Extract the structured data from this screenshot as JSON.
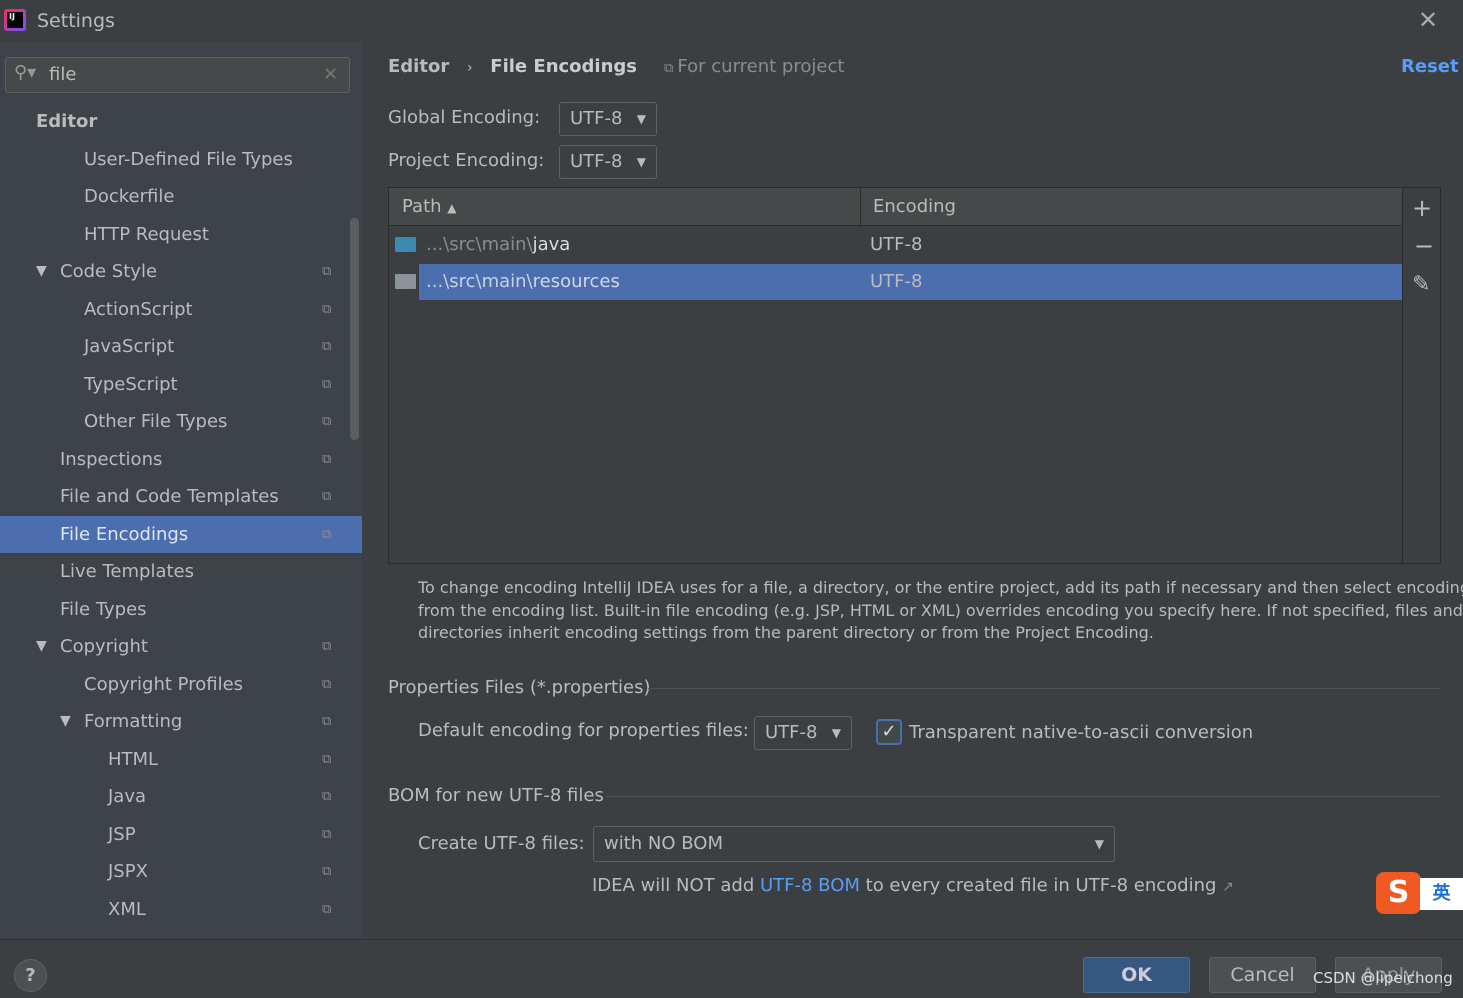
{
  "window": {
    "title": "Settings",
    "close_icon": "close-icon",
    "app_icon": "intellij-idea-logo"
  },
  "search": {
    "value": "file"
  },
  "tree": [
    {
      "label": "Editor",
      "level": 0,
      "bold": true
    },
    {
      "label": "User-Defined File Types",
      "level": 2
    },
    {
      "label": "Dockerfile",
      "level": 2
    },
    {
      "label": "HTTP Request",
      "level": 2
    },
    {
      "label": "Code Style",
      "level": 1,
      "expanded": true,
      "copy": true
    },
    {
      "label": "ActionScript",
      "level": 2,
      "copy": true
    },
    {
      "label": "JavaScript",
      "level": 2,
      "copy": true
    },
    {
      "label": "TypeScript",
      "level": 2,
      "copy": true
    },
    {
      "label": "Other File Types",
      "level": 2,
      "copy": true
    },
    {
      "label": "Inspections",
      "level": 1,
      "copy": true
    },
    {
      "label": "File and Code Templates",
      "level": 1,
      "copy": true
    },
    {
      "label": "File Encodings",
      "level": 1,
      "copy": true,
      "selected": true
    },
    {
      "label": "Live Templates",
      "level": 1
    },
    {
      "label": "File Types",
      "level": 1
    },
    {
      "label": "Copyright",
      "level": 1,
      "expanded": true,
      "copy": true
    },
    {
      "label": "Copyright Profiles",
      "level": 2,
      "copy": true
    },
    {
      "label": "Formatting",
      "level": 2,
      "expanded": true,
      "copy": true
    },
    {
      "label": "HTML",
      "level": 3,
      "copy": true
    },
    {
      "label": "Java",
      "level": 3,
      "copy": true
    },
    {
      "label": "JSP",
      "level": 3,
      "copy": true
    },
    {
      "label": "JSPX",
      "level": 3,
      "copy": true
    },
    {
      "label": "XML",
      "level": 3,
      "copy": true
    }
  ],
  "header": {
    "crumb1": "Editor",
    "crumb2": "File Encodings",
    "scope": "For current project",
    "reset": "Reset"
  },
  "global": {
    "label": "Global Encoding:",
    "value": "UTF-8"
  },
  "project": {
    "label": "Project Encoding:",
    "value": "UTF-8"
  },
  "table": {
    "col_path": "Path",
    "col_enc": "Encoding",
    "rows": [
      {
        "prefix": "...\\src\\main\\",
        "name": "java",
        "enc": "UTF-8",
        "icon": "folder-icon"
      },
      {
        "prefix": "...\\src\\main\\",
        "name": "resources",
        "enc": "UTF-8",
        "icon": "resources-folder-icon",
        "selected": true
      }
    ]
  },
  "hint": [
    "To change encoding IntelliJ IDEA uses for a file, a directory, or the entire project, add its path if necessary and then select encoding",
    "from the encoding list. Built-in file encoding (e.g. JSP, HTML or XML) overrides encoding you specify here. If not specified, files and",
    "directories inherit encoding settings from the parent directory or from the Project Encoding."
  ],
  "props": {
    "section": "Properties Files (*.properties)",
    "label": "Default encoding for properties files:",
    "value": "UTF-8",
    "checkbox": "Transparent native-to-ascii conversion",
    "checked": true
  },
  "bom": {
    "section": "BOM for new UTF-8 files",
    "label": "Create UTF-8 files:",
    "value": "with NO BOM",
    "note_pre": "IDEA will NOT add ",
    "note_link": "UTF-8 BOM",
    "note_post": " to every created file in UTF-8 encoding"
  },
  "footer": {
    "ok": "OK",
    "cancel": "Cancel",
    "apply": "Apply",
    "help": "?",
    "watermark": "CSDN @lipeichong"
  },
  "ime": {
    "label": "英"
  },
  "colors": {
    "selection": "#4b6eaf",
    "link": "#589df6",
    "bg": "#3c3f41"
  }
}
